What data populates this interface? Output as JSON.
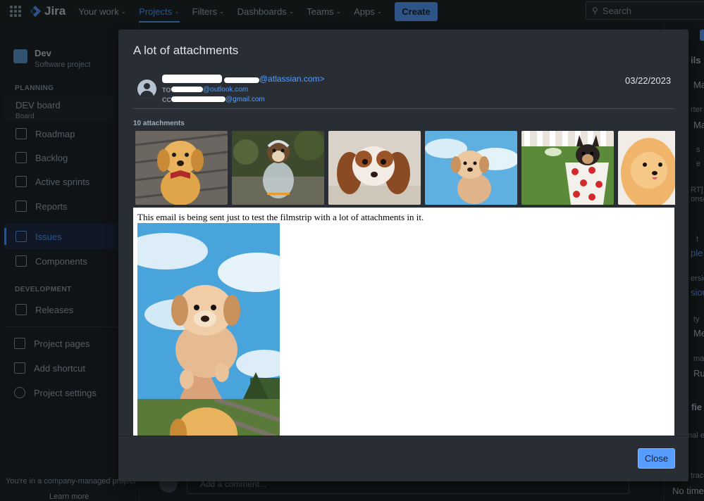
{
  "topnav": {
    "app_name": "Jira",
    "items": [
      {
        "label": "Your work"
      },
      {
        "label": "Projects"
      },
      {
        "label": "Filters"
      },
      {
        "label": "Dashboards"
      },
      {
        "label": "Teams"
      },
      {
        "label": "Apps"
      }
    ],
    "create_label": "Create",
    "search_placeholder": "Search"
  },
  "sidebar": {
    "project_name": "Dev",
    "project_type": "Software project",
    "planning_label": "PLANNING",
    "board_title": "DEV board",
    "board_sub": "Board",
    "planning_items": [
      {
        "label": "Roadmap"
      },
      {
        "label": "Backlog"
      },
      {
        "label": "Active sprints"
      },
      {
        "label": "Reports"
      }
    ],
    "issues_label": "Issues",
    "components_label": "Components",
    "development_label": "DEVELOPMENT",
    "releases_label": "Releases",
    "bottom_items": [
      {
        "label": "Project pages"
      },
      {
        "label": "Add shortcut"
      },
      {
        "label": "Project settings"
      }
    ],
    "footer_text": "You're in a company-managed project",
    "learn_more": "Learn more"
  },
  "right_panel": {
    "snippets": [
      "ils",
      "Ma",
      "rter",
      "Ma",
      "s",
      "e",
      "RT]",
      "onse",
      "t",
      "ple S",
      "ersio",
      "sion",
      "ty",
      "Me",
      "mati",
      "Rul",
      "e fie",
      "nal e",
      "trac",
      "No time"
    ]
  },
  "background": {
    "comment_placeholder": "Add a comment..."
  },
  "modal": {
    "title": "A lot of attachments",
    "from_suffix": "@atlassian.com>",
    "to_label": "TO",
    "to_suffix": "@outlook.com",
    "cc_label": "CC",
    "cc_suffix": "@gmail.com",
    "date": "03/22/2023",
    "attachments_label": "10 attachments",
    "body_text": "This email is being sent just to test the filmstrip with a lot of attachments in it.",
    "close_label": "Close"
  },
  "colors": {
    "accent": "#579dff",
    "background": "#1d2125",
    "modal": "#282e33"
  }
}
